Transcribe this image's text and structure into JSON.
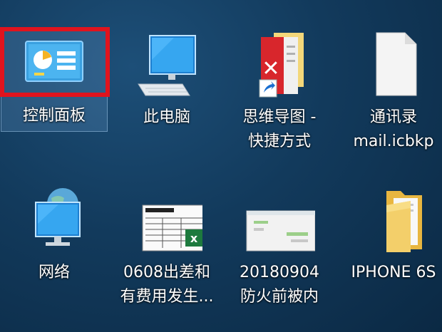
{
  "desktop": {
    "icons": [
      {
        "label": "控制面板"
      },
      {
        "label": "此电脑"
      },
      {
        "label": "思维导图 -\n快捷方式"
      },
      {
        "label": "通讯录\nmail.icbkp"
      },
      {
        "label": "网络"
      },
      {
        "label": "0608出差和\n有费用发生..."
      },
      {
        "label": "20180904\n防火前被内"
      },
      {
        "label": "IPHONE 6S"
      }
    ],
    "highlight_color": "#e0141e",
    "selected_icon": "控制面板"
  }
}
